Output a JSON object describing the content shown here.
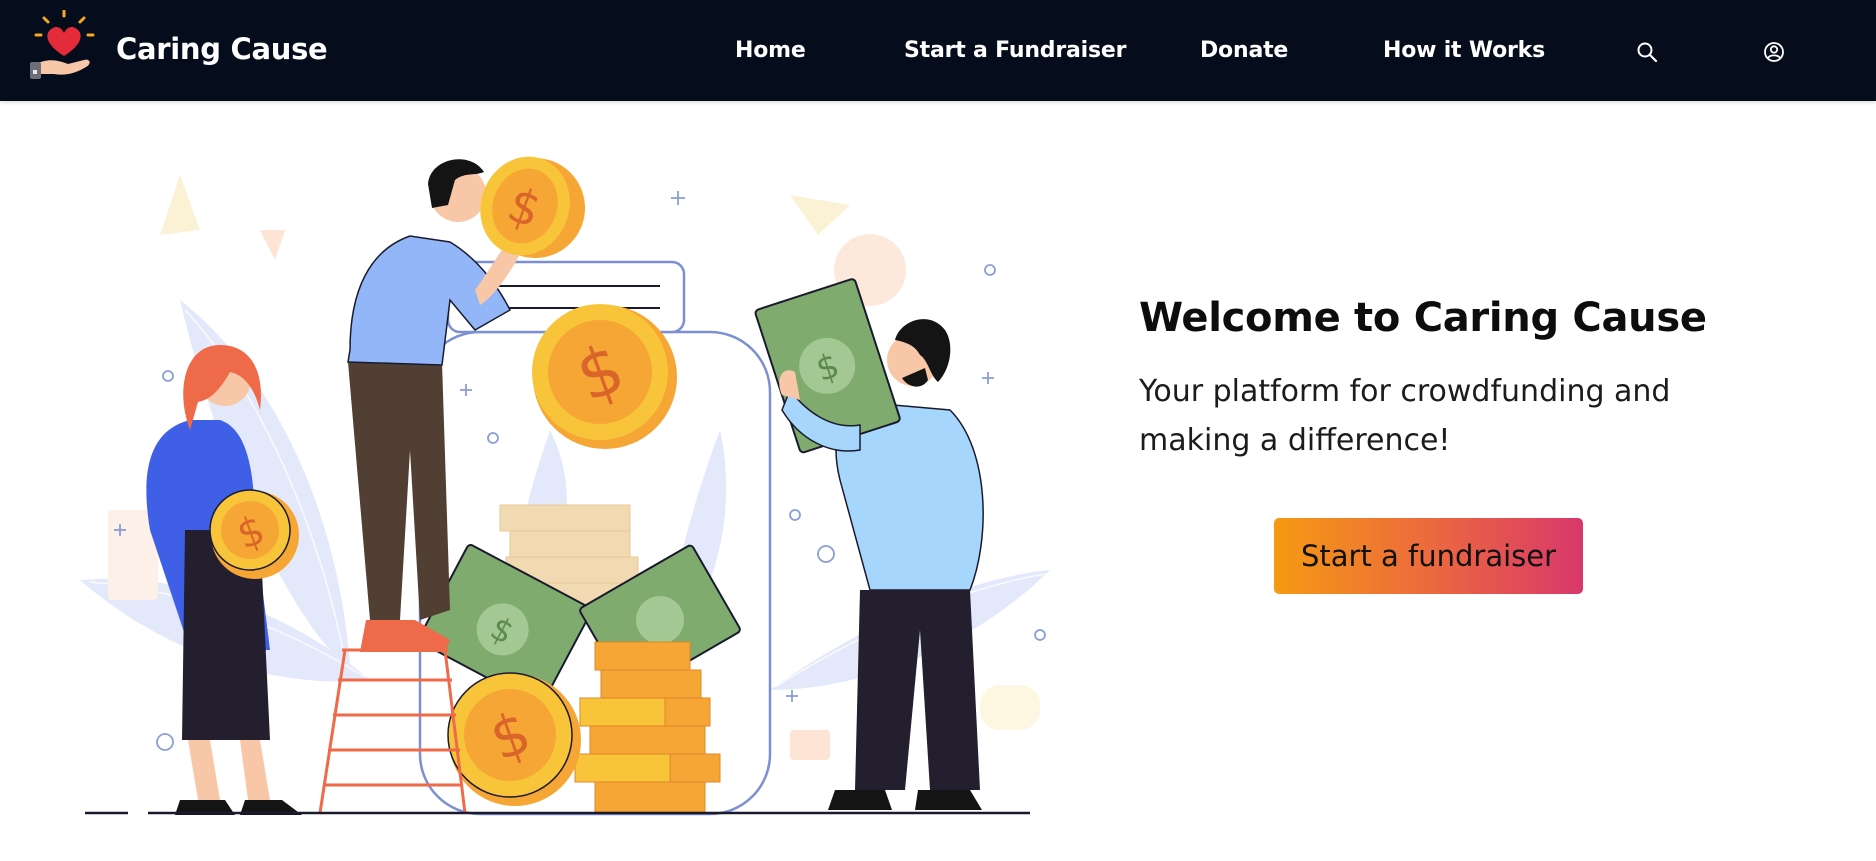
{
  "header": {
    "brand_name": "Caring Cause",
    "logo_icon": "heart-in-hand-icon",
    "nav": [
      {
        "label": "Home"
      },
      {
        "label": "Start a Fundraiser"
      },
      {
        "label": "Donate"
      },
      {
        "label": "How it Works"
      }
    ],
    "search_icon": "search-icon",
    "account_icon": "user-circle-icon"
  },
  "hero": {
    "title": "Welcome to Caring Cause",
    "subtitle": "Your platform for crowdfunding and making a difference!",
    "cta_label": "Start a fundraiser",
    "illustration": "people-donating-coins-jar-illustration"
  },
  "colors": {
    "navbar_bg": "#050d1c",
    "cta_gradient_start": "#f59a12",
    "cta_gradient_end": "#d8376a",
    "coin": "#f8c53a"
  }
}
